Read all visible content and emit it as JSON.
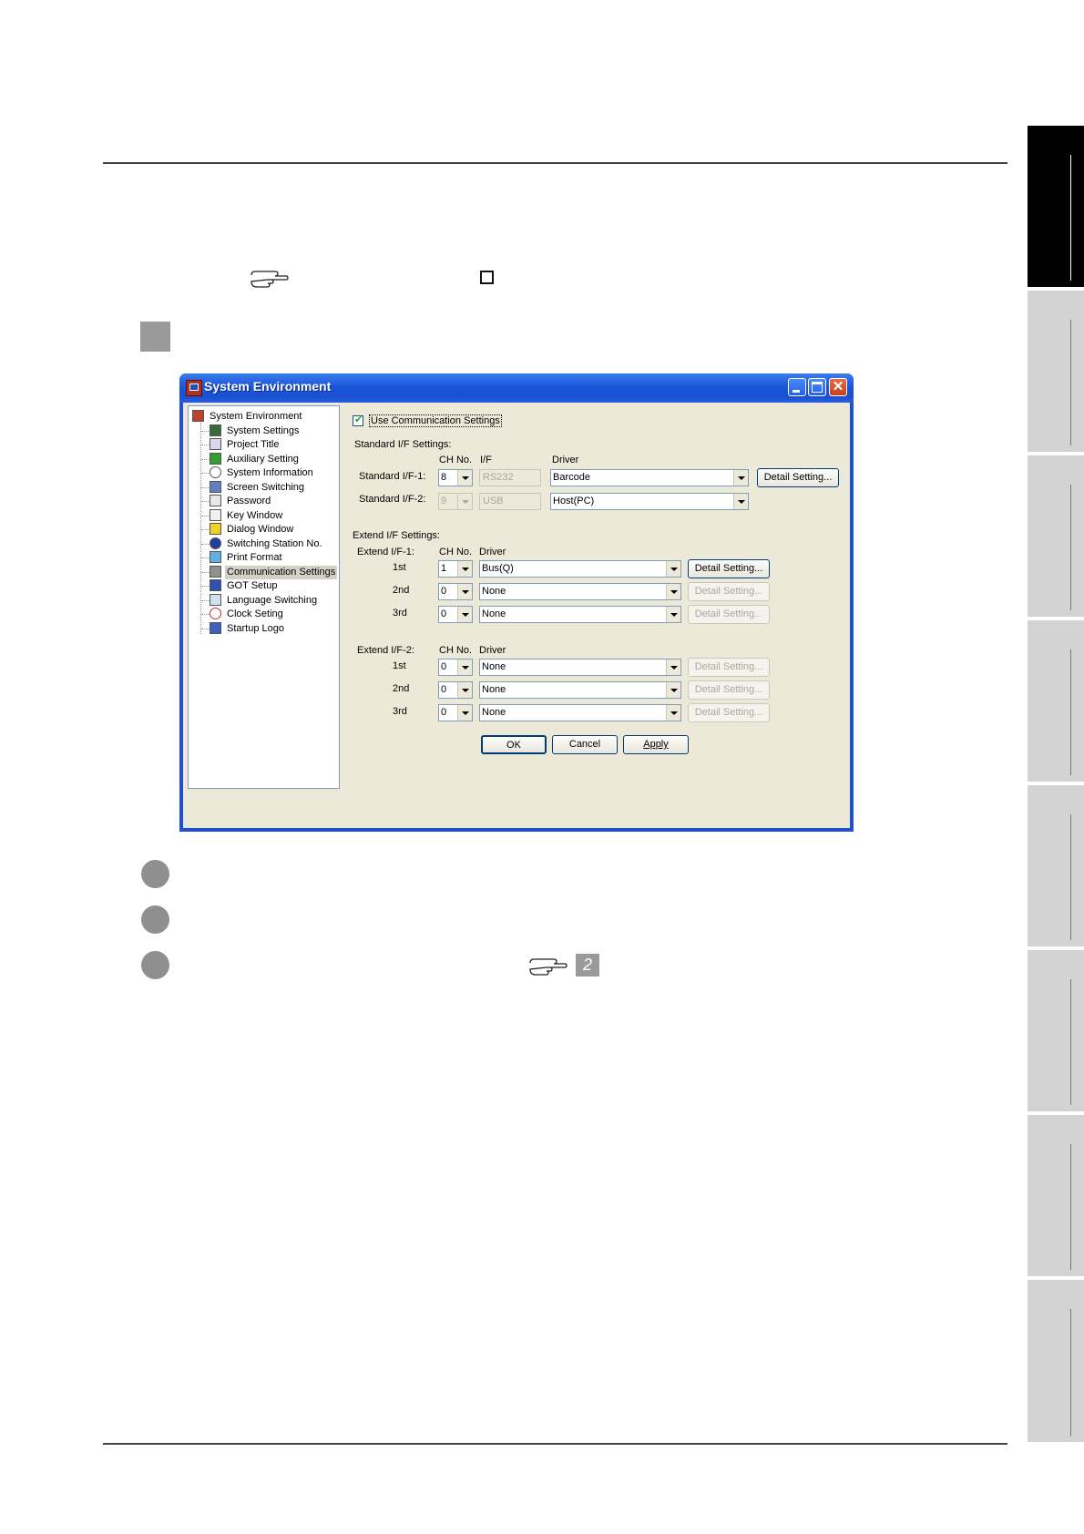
{
  "window": {
    "title": "System Environment",
    "buttons": {
      "minimize": "minimize-icon",
      "maximize": "maximize-icon",
      "close": "close-icon"
    }
  },
  "tree": {
    "root": "System Environment",
    "items": [
      {
        "label": "System Settings"
      },
      {
        "label": "Project Title"
      },
      {
        "label": "Auxiliary Setting"
      },
      {
        "label": "System Information"
      },
      {
        "label": "Screen Switching"
      },
      {
        "label": "Password"
      },
      {
        "label": "Key Window"
      },
      {
        "label": "Dialog Window"
      },
      {
        "label": "Switching Station No."
      },
      {
        "label": "Print Format"
      },
      {
        "label": "Communication Settings"
      },
      {
        "label": "GOT Setup"
      },
      {
        "label": "Language Switching"
      },
      {
        "label": "Clock Seting"
      },
      {
        "label": "Startup Logo"
      }
    ],
    "selected": "Communication Settings"
  },
  "form": {
    "use_comm_label": "Use Communication Settings",
    "standard_section": "Standard I/F Settings:",
    "col_ch_no": "CH No.",
    "col_if": "I/F",
    "col_driver": "Driver",
    "std1": {
      "label": "Standard I/F-1:",
      "ch": "8",
      "if": "RS232",
      "driver": "Barcode",
      "detail": "Detail Setting..."
    },
    "std2": {
      "label": "Standard I/F-2:",
      "ch": "9",
      "if": "USB",
      "driver": "Host(PC)"
    },
    "extend_section": "Extend I/F Settings:",
    "ext1": {
      "label": "Extend I/F-1:",
      "rows": [
        {
          "ord": "1st",
          "ch": "1",
          "driver": "Bus(Q)",
          "detail": "Detail Setting..."
        },
        {
          "ord": "2nd",
          "ch": "0",
          "driver": "None",
          "detail": "Detail Setting..."
        },
        {
          "ord": "3rd",
          "ch": "0",
          "driver": "None",
          "detail": "Detail Setting..."
        }
      ]
    },
    "ext2": {
      "label": "Extend I/F-2:",
      "rows": [
        {
          "ord": "1st",
          "ch": "0",
          "driver": "None",
          "detail": "Detail Setting..."
        },
        {
          "ord": "2nd",
          "ch": "0",
          "driver": "None",
          "detail": "Detail Setting..."
        },
        {
          "ord": "3rd",
          "ch": "0",
          "driver": "None",
          "detail": "Detail Setting..."
        }
      ]
    },
    "ok": "OK",
    "cancel": "Cancel",
    "apply": "Apply"
  },
  "page": {
    "reference_icons": [
      "pointing-hand-icon",
      "pointing-hand-icon"
    ],
    "ref_badge": "2",
    "step_markers": 3
  },
  "colors": {
    "titlebar": "#1b56dc",
    "dialog_bg": "#ece9d8",
    "side_tab": "#d3d3d3",
    "side_tab_active": "#000000",
    "marker_gray": "#9a9a9a"
  }
}
